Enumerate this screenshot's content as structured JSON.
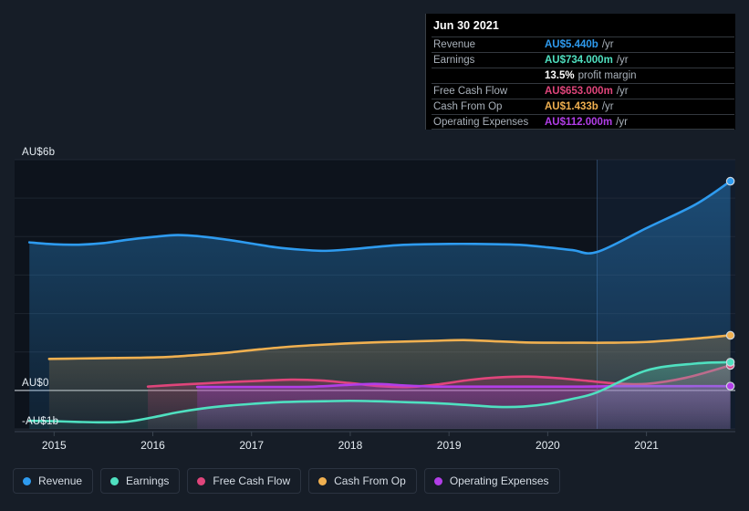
{
  "tooltip": {
    "date": "Jun 30 2021",
    "rows": [
      {
        "label": "Revenue",
        "value": "AU$5.440b",
        "unit": "/yr",
        "color": "#2e9bef"
      },
      {
        "label": "Earnings",
        "value": "AU$734.000m",
        "unit": "/yr",
        "color": "#4fe0c0"
      },
      {
        "label": "",
        "value": "13.5%",
        "unit": "profit margin",
        "color": "#ffffff"
      },
      {
        "label": "Free Cash Flow",
        "value": "AU$653.000m",
        "unit": "/yr",
        "color": "#e0457b"
      },
      {
        "label": "Cash From Op",
        "value": "AU$1.433b",
        "unit": "/yr",
        "color": "#f0b050"
      },
      {
        "label": "Operating Expenses",
        "value": "AU$112.000m",
        "unit": "/yr",
        "color": "#b23ee8"
      }
    ]
  },
  "legend": {
    "items": [
      {
        "label": "Revenue",
        "color": "#2e9bef"
      },
      {
        "label": "Earnings",
        "color": "#4fe0c0"
      },
      {
        "label": "Free Cash Flow",
        "color": "#e0457b"
      },
      {
        "label": "Cash From Op",
        "color": "#f0b050"
      },
      {
        "label": "Operating Expenses",
        "color": "#b23ee8"
      }
    ]
  },
  "chart_data": {
    "type": "area",
    "title": "",
    "xlabel": "",
    "ylabel": "",
    "grid": true,
    "legend_position": "bottom",
    "currency": "AU$",
    "ylim": [
      -1,
      6
    ],
    "y_ticks": [
      {
        "label": "AU$6b",
        "value": 6
      },
      {
        "label": "AU$0",
        "value": 0
      },
      {
        "label": "-AU$1b",
        "value": -1
      }
    ],
    "x_ticks": [
      "2015",
      "2016",
      "2017",
      "2018",
      "2019",
      "2020",
      "2021"
    ],
    "xlim": [
      "2014.6",
      "2021.9"
    ],
    "forecast_start": "2020.5",
    "series": [
      {
        "name": "Revenue",
        "color": "#2e9bef",
        "x": [
          2014.75,
          2015.0,
          2015.25,
          2015.5,
          2015.75,
          2016.0,
          2016.25,
          2016.5,
          2016.75,
          2017.0,
          2017.25,
          2017.5,
          2017.75,
          2018.0,
          2018.25,
          2018.5,
          2018.75,
          2019.0,
          2019.25,
          2019.5,
          2019.75,
          2020.0,
          2020.25,
          2020.5,
          2021.0,
          2021.5,
          2021.85
        ],
        "values": [
          3.85,
          3.8,
          3.79,
          3.83,
          3.92,
          3.99,
          4.04,
          4.0,
          3.92,
          3.82,
          3.72,
          3.66,
          3.63,
          3.67,
          3.73,
          3.78,
          3.8,
          3.81,
          3.81,
          3.8,
          3.78,
          3.72,
          3.65,
          3.6,
          4.22,
          4.84,
          5.44
        ]
      },
      {
        "name": "Earnings",
        "color": "#4fe0c0",
        "x": [
          2014.75,
          2015.0,
          2015.25,
          2015.5,
          2015.75,
          2016.0,
          2016.25,
          2016.5,
          2016.75,
          2017.0,
          2017.25,
          2017.5,
          2017.75,
          2018.0,
          2018.25,
          2018.5,
          2018.75,
          2019.0,
          2019.25,
          2019.5,
          2019.75,
          2020.0,
          2020.25,
          2020.5,
          2021.0,
          2021.5,
          2021.85
        ],
        "values": [
          -0.79,
          -0.8,
          -0.82,
          -0.83,
          -0.81,
          -0.7,
          -0.57,
          -0.47,
          -0.4,
          -0.35,
          -0.31,
          -0.29,
          -0.28,
          -0.27,
          -0.28,
          -0.3,
          -0.32,
          -0.35,
          -0.39,
          -0.43,
          -0.42,
          -0.35,
          -0.22,
          -0.05,
          0.52,
          0.7,
          0.734
        ]
      },
      {
        "name": "Free Cash Flow",
        "color": "#e0457b",
        "x": [
          2015.95,
          2016.2,
          2016.5,
          2016.8,
          2017.1,
          2017.4,
          2017.7,
          2018.0,
          2018.3,
          2018.6,
          2018.9,
          2019.2,
          2019.5,
          2019.8,
          2020.1,
          2020.4,
          2020.7,
          2021.0,
          2021.4,
          2021.85
        ],
        "values": [
          0.1,
          0.14,
          0.18,
          0.22,
          0.25,
          0.28,
          0.26,
          0.19,
          0.11,
          0.09,
          0.16,
          0.27,
          0.34,
          0.36,
          0.32,
          0.25,
          0.18,
          0.17,
          0.33,
          0.653
        ]
      },
      {
        "name": "Cash From Op",
        "color": "#f0b050",
        "x": [
          2014.95,
          2015.25,
          2015.55,
          2015.85,
          2016.15,
          2016.45,
          2016.75,
          2017.05,
          2017.35,
          2017.65,
          2017.95,
          2018.25,
          2018.55,
          2018.85,
          2019.15,
          2019.45,
          2019.75,
          2020.05,
          2020.35,
          2020.6,
          2021.0,
          2021.45,
          2021.85
        ],
        "values": [
          0.82,
          0.83,
          0.84,
          0.85,
          0.87,
          0.92,
          0.98,
          1.06,
          1.13,
          1.18,
          1.22,
          1.25,
          1.27,
          1.29,
          1.31,
          1.28,
          1.25,
          1.24,
          1.24,
          1.24,
          1.26,
          1.34,
          1.433
        ]
      },
      {
        "name": "Operating Expenses",
        "color": "#b23ee8",
        "x": [
          2016.45,
          2016.75,
          2017.05,
          2017.35,
          2017.65,
          2017.95,
          2018.25,
          2018.55,
          2018.85,
          2019.15,
          2019.45,
          2019.75,
          2020.05,
          2020.35,
          2020.65,
          2021.0,
          2021.45,
          2021.85
        ],
        "values": [
          0.09,
          0.09,
          0.09,
          0.09,
          0.1,
          0.14,
          0.17,
          0.13,
          0.1,
          0.1,
          0.1,
          0.1,
          0.1,
          0.1,
          0.11,
          0.11,
          0.112,
          0.112
        ]
      }
    ]
  }
}
